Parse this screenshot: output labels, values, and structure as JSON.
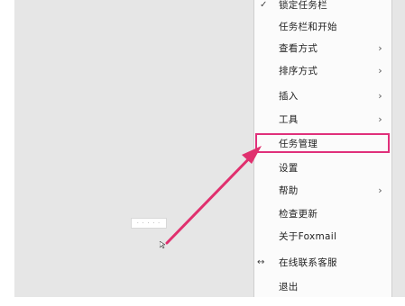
{
  "menu": {
    "items": [
      {
        "label": "锁定任务栏",
        "checked": true,
        "submenu": false
      },
      {
        "label": "任务栏和开始",
        "checked": false,
        "submenu": false
      },
      {
        "label": "查看方式",
        "checked": false,
        "submenu": true
      },
      {
        "label": "排序方式",
        "checked": false,
        "submenu": true
      },
      {
        "label": "插入",
        "checked": false,
        "submenu": true
      },
      {
        "label": "工具",
        "checked": false,
        "submenu": true
      },
      {
        "label": "任务管理",
        "checked": false,
        "submenu": false
      },
      {
        "label": "设置",
        "checked": false,
        "submenu": false
      },
      {
        "label": "帮助",
        "checked": false,
        "submenu": true
      },
      {
        "label": "检查更新",
        "checked": false,
        "submenu": false
      },
      {
        "label": "关于Foxmail",
        "checked": false,
        "submenu": false
      },
      {
        "label": "在线联系客服",
        "checked": false,
        "submenu": false
      },
      {
        "label": "退出",
        "checked": false,
        "submenu": false
      }
    ]
  },
  "toast_text": "· · · · ·",
  "colors": {
    "highlight": "#e0307a",
    "arrow": "#e0306e"
  },
  "icons": {
    "check": "check-icon",
    "submenu": "chevron-right-icon",
    "pointer": "cursor-icon"
  }
}
